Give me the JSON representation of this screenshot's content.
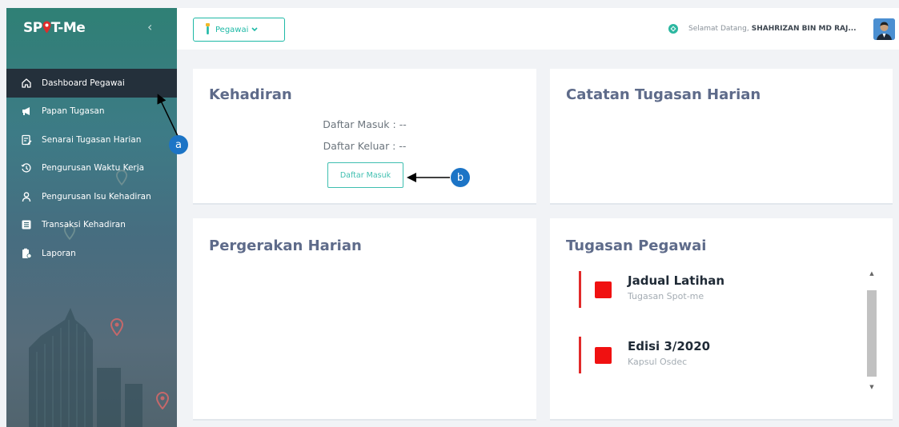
{
  "app": {
    "logo_text_pre": "SP",
    "logo_text_post": "T-Me"
  },
  "sidebar": {
    "items": [
      {
        "label": "Dashboard Pegawai",
        "icon": "home-icon"
      },
      {
        "label": "Papan Tugasan",
        "icon": "megaphone-icon"
      },
      {
        "label": "Senarai Tugasan Harian",
        "icon": "edit-list-icon"
      },
      {
        "label": "Pengurusan Waktu Kerja",
        "icon": "history-icon"
      },
      {
        "label": "Pengurusan Isu Kehadiran",
        "icon": "person-icon"
      },
      {
        "label": "Transaksi Kehadiran",
        "icon": "list-icon"
      },
      {
        "label": "Laporan",
        "icon": "report-icon"
      }
    ]
  },
  "header": {
    "role_button": "Pegawai",
    "greeting": "Selamat Datang,",
    "user_name": "SHAHRIZAN BIN MD RAJ..."
  },
  "kehadiran": {
    "title": "Kehadiran",
    "daftar_masuk": "Daftar Masuk : --",
    "daftar_keluar": "Daftar Keluar : --",
    "button_label": "Daftar Masuk"
  },
  "catatan": {
    "title": "Catatan Tugasan Harian"
  },
  "pergerakan": {
    "title": "Pergerakan Harian"
  },
  "tugasan_pegawai": {
    "title": "Tugasan Pegawai",
    "tasks": [
      {
        "title": "Jadual Latihan",
        "subtitle": "Tugasan Spot-me"
      },
      {
        "title": "Edisi 3/2020",
        "subtitle": "Kapsul Osdec"
      }
    ]
  },
  "annotations": {
    "a": "a",
    "b": "b"
  },
  "colors": {
    "accent": "#1eb9a6",
    "title": "#5e6b8a",
    "task_red": "#f01111",
    "sidebar_active": "#24303b",
    "callout": "#1c74c6"
  }
}
